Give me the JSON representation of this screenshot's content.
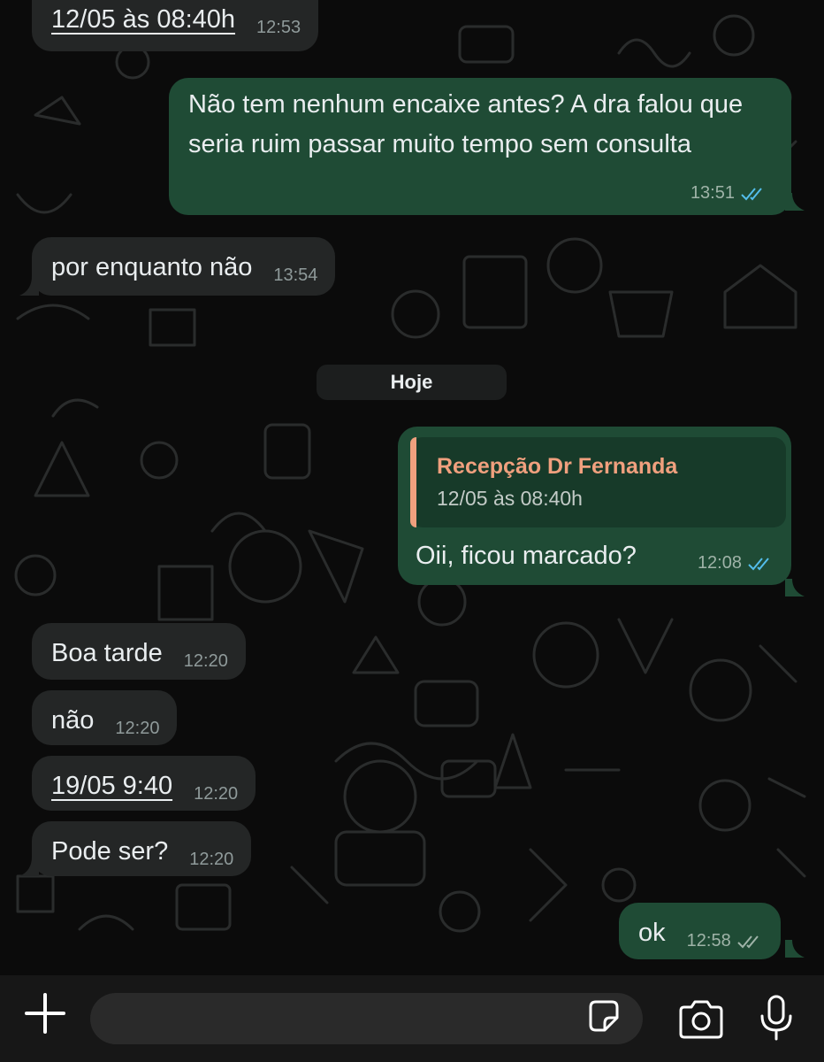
{
  "colors": {
    "background": "#0b0b0b",
    "incoming_bubble": "#242626",
    "outgoing_bubble": "#1f4b35",
    "quote_accent": "#f0a07e",
    "read_tick": "#53bdeb",
    "delivered_tick": "#9fb3a8"
  },
  "messages": [
    {
      "text": "12/05 às 08:40h",
      "time": "12:53",
      "direction": "incoming",
      "is_link": true
    },
    {
      "text": "Não tem nenhum encaixe antes? A dra falou que seria ruim passar muito tempo sem consulta",
      "time": "13:51",
      "direction": "outgoing",
      "status": "read"
    },
    {
      "text": "por enquanto não",
      "time": "13:54",
      "direction": "incoming"
    },
    {
      "quote_author": "Recepção Dr Fernanda",
      "quote_text": "12/05 às 08:40h",
      "text": "Oii, ficou marcado?",
      "time": "12:08",
      "direction": "outgoing",
      "status": "read"
    },
    {
      "text": "Boa tarde",
      "time": "12:20",
      "direction": "incoming"
    },
    {
      "text": "não",
      "time": "12:20",
      "direction": "incoming"
    },
    {
      "text": "19/05 9:40",
      "time": "12:20",
      "direction": "incoming",
      "is_link": true
    },
    {
      "text": "Pode ser?",
      "time": "12:20",
      "direction": "incoming"
    },
    {
      "text": "ok",
      "time": "12:58",
      "direction": "outgoing",
      "status": "delivered"
    }
  ],
  "date_separator": "Hoje",
  "composer": {
    "attach_icon": "plus-icon",
    "sticker_icon": "sticker-icon",
    "camera_icon": "camera-icon",
    "mic_icon": "microphone-icon",
    "input_value": ""
  }
}
